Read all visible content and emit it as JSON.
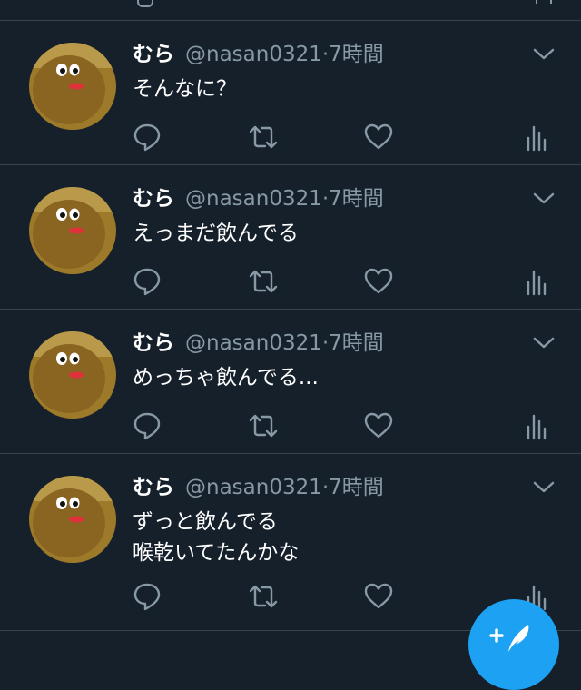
{
  "timeline": {
    "tweets": [
      {
        "display_name": "むら",
        "handle": "@nasan0321",
        "separator": "·",
        "time": "7時間",
        "text_lines": [
          "そんなに？"
        ]
      },
      {
        "display_name": "むら",
        "handle": "@nasan0321",
        "separator": "·",
        "time": "7時間",
        "text_lines": [
          "えっまだ飲んでる"
        ]
      },
      {
        "display_name": "むら",
        "handle": "@nasan0321",
        "separator": "·",
        "time": "7時間",
        "text_lines": [
          "めっちゃ飲んでる..."
        ]
      },
      {
        "display_name": "むら",
        "handle": "@nasan0321",
        "separator": "·",
        "time": "7時間",
        "text_lines": [
          "ずっと飲んでる",
          "喉乾いてたんかな"
        ]
      }
    ],
    "action_icons": [
      "reply-icon",
      "retweet-icon",
      "like-icon",
      "analytics-icon"
    ]
  },
  "fab": {
    "icon": "compose-tweet-icon"
  },
  "colors": {
    "background": "#15202b",
    "divider": "#38444d",
    "text_primary": "#ffffff",
    "text_secondary": "#8899a6",
    "accent": "#1da1f2"
  }
}
